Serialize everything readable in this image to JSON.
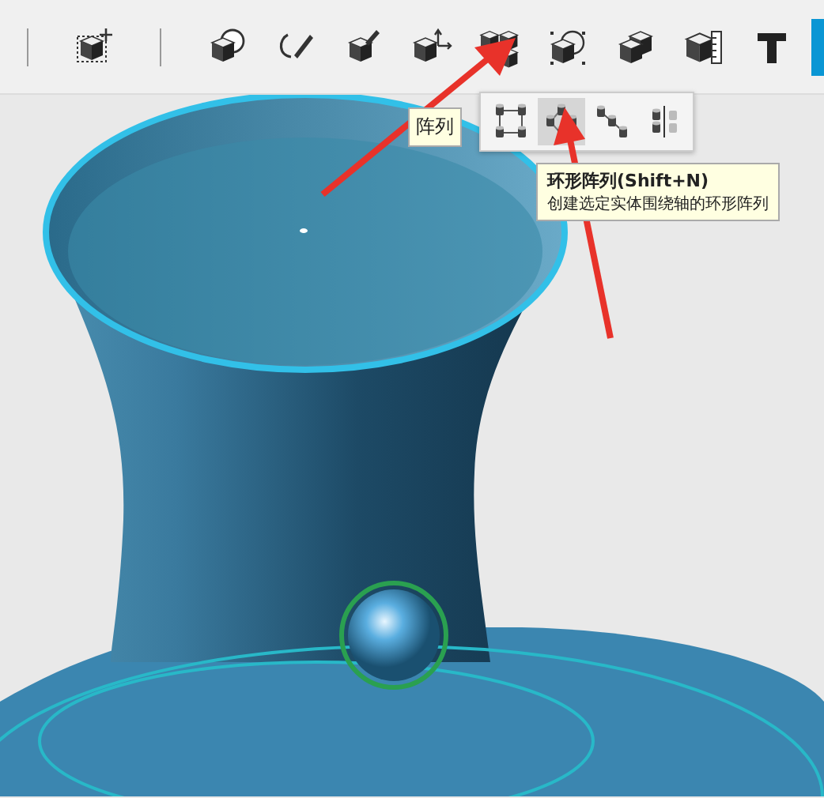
{
  "toolbar": {
    "tools": [
      {
        "kind": "move"
      },
      {
        "kind": "combine"
      },
      {
        "kind": "sketch"
      },
      {
        "kind": "paint"
      },
      {
        "kind": "transform"
      },
      {
        "kind": "pattern"
      },
      {
        "kind": "select"
      },
      {
        "kind": "solid"
      },
      {
        "kind": "measure"
      },
      {
        "kind": "text"
      }
    ]
  },
  "pattern_label": "阵列",
  "flyout": {
    "items": [
      {
        "kind": "rectangular",
        "selected": false
      },
      {
        "kind": "circular",
        "selected": true
      },
      {
        "kind": "linear",
        "selected": false
      },
      {
        "kind": "mirror",
        "selected": false
      }
    ]
  },
  "tooltip": {
    "title": "环形阵列(Shift+N)",
    "description": "创建选定实体围绕轴的环形阵列"
  }
}
